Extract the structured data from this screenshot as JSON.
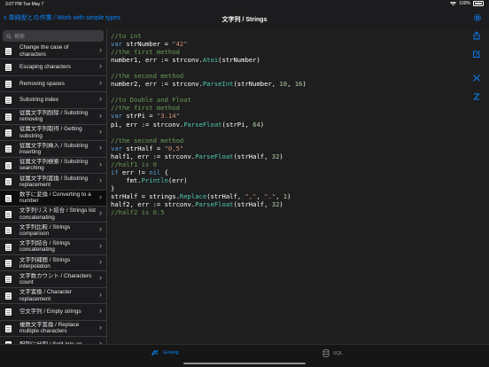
{
  "status": {
    "time": "3:07 PM",
    "date": "Tue May 7",
    "battery": "100%"
  },
  "nav": {
    "back_label": "単純型との作業 / Work with simple types",
    "title": "文字列 / Strings"
  },
  "sidebar": {
    "search_placeholder": "検索",
    "items": [
      {
        "label": "Change the case of characters"
      },
      {
        "label": "Escaping characters"
      },
      {
        "label": "Removing spaces"
      },
      {
        "label": "Substring index"
      },
      {
        "label": "従属文字列削除 / Substring removing"
      },
      {
        "label": "従属文字列取得 / Getting substring"
      },
      {
        "label": "従属文字列挿入 / Substring inserting"
      },
      {
        "label": "従属文字列検索 / Substring searching"
      },
      {
        "label": "従属文字列置換 / Substring replacement"
      },
      {
        "label": "数字に変換 / Converting to a number",
        "active": true
      },
      {
        "label": "文字列リスト結合 / Strings list concatenating"
      },
      {
        "label": "文字列比較 / Strings comparison"
      },
      {
        "label": "文字列結合 / Strings concatenating"
      },
      {
        "label": "文字列補間 / Strings interpolation"
      },
      {
        "label": "文字数カウント / Characters count"
      },
      {
        "label": "文字置換 / Character replacement"
      },
      {
        "label": "空文字列 / Empty strings"
      },
      {
        "label": "複数文字置換 / Replace multiple characters"
      },
      {
        "label": "配列に分割 / Split into an"
      }
    ]
  },
  "code": {
    "lines": [
      [
        [
          "com",
          "//to int"
        ]
      ],
      [
        [
          "key",
          "var "
        ],
        [
          "txt",
          "strNumber = "
        ],
        [
          "str",
          "\"42\""
        ]
      ],
      [
        [
          "com",
          "//the first method"
        ]
      ],
      [
        [
          "txt",
          "number1, err := strconv."
        ],
        [
          "fn",
          "Atoi"
        ],
        [
          "txt",
          "(strNumber)"
        ]
      ],
      [],
      [
        [
          "com",
          "//the second method"
        ]
      ],
      [
        [
          "txt",
          "number2, err := strconv."
        ],
        [
          "fn",
          "ParseInt"
        ],
        [
          "txt",
          "(strNumber, "
        ],
        [
          "num",
          "10"
        ],
        [
          "txt",
          ", "
        ],
        [
          "num",
          "16"
        ],
        [
          "txt",
          ")"
        ]
      ],
      [],
      [
        [
          "com",
          "//to Double and Float"
        ]
      ],
      [
        [
          "com",
          "//the first method"
        ]
      ],
      [
        [
          "key",
          "var "
        ],
        [
          "txt",
          "strPi = "
        ],
        [
          "str",
          "\"3.14\""
        ]
      ],
      [
        [
          "txt",
          "pi, err := strconv."
        ],
        [
          "fn",
          "ParseFloat"
        ],
        [
          "txt",
          "(strPi, "
        ],
        [
          "num",
          "64"
        ],
        [
          "txt",
          ")"
        ]
      ],
      [],
      [
        [
          "com",
          "//the second method"
        ]
      ],
      [
        [
          "key",
          "var "
        ],
        [
          "txt",
          "strHalf = "
        ],
        [
          "str",
          "\"0,5\""
        ]
      ],
      [
        [
          "txt",
          "half1, err := strconv."
        ],
        [
          "fn",
          "ParseFloat"
        ],
        [
          "txt",
          "(strHalf, "
        ],
        [
          "num",
          "32"
        ],
        [
          "txt",
          ")"
        ]
      ],
      [
        [
          "com",
          "//half1 is 0"
        ]
      ],
      [
        [
          "key",
          "if "
        ],
        [
          "txt",
          "err != "
        ],
        [
          "key",
          "nil"
        ],
        [
          "txt",
          " {"
        ]
      ],
      [
        [
          "txt",
          "    fmt."
        ],
        [
          "fn",
          "Println"
        ],
        [
          "txt",
          "(err)"
        ]
      ],
      [
        [
          "txt",
          "}"
        ]
      ],
      [
        [
          "txt",
          "strHalf = strings."
        ],
        [
          "fn",
          "Replace"
        ],
        [
          "txt",
          "(strHalf, "
        ],
        [
          "str",
          "\",\""
        ],
        [
          "txt",
          ", "
        ],
        [
          "str",
          "\".\""
        ],
        [
          "txt",
          ", "
        ],
        [
          "num",
          "1"
        ],
        [
          "txt",
          ")"
        ]
      ],
      [
        [
          "txt",
          "half2, err := strconv."
        ],
        [
          "fn",
          "ParseFloat"
        ],
        [
          "txt",
          "(strHalf, "
        ],
        [
          "num",
          "32"
        ],
        [
          "txt",
          ")"
        ]
      ],
      [
        [
          "com",
          "//half2 is 0.5"
        ]
      ]
    ]
  },
  "tabs": {
    "golang": "Golang",
    "sql": "SQL"
  },
  "colors": {
    "accent": "#0a84ff",
    "comment": "#6a9955",
    "keyword": "#569cd6",
    "string": "#ce9178",
    "number": "#b5cea8",
    "function": "#4ec9b0"
  }
}
